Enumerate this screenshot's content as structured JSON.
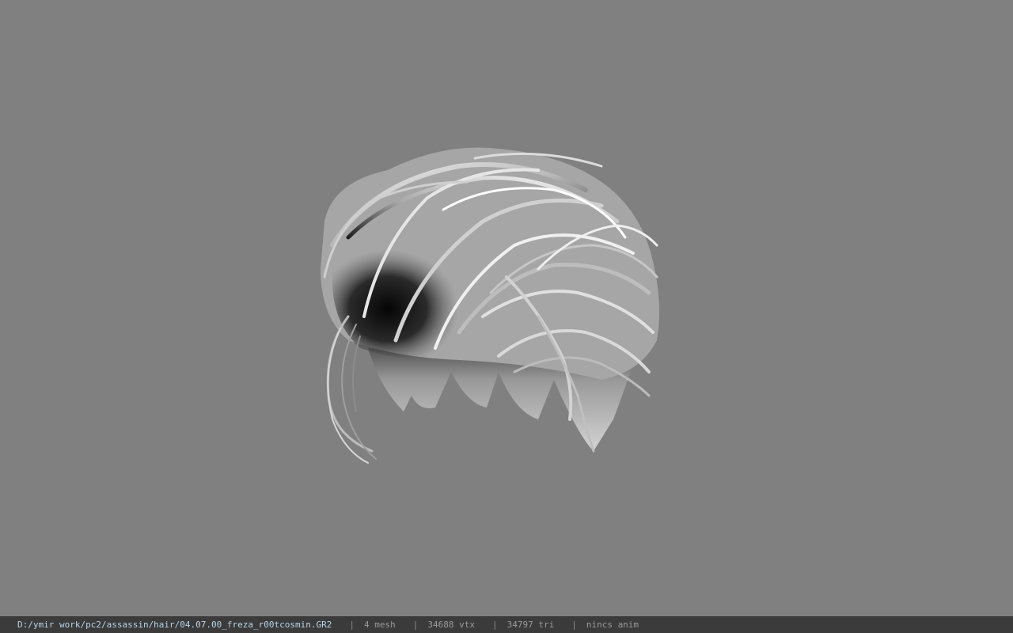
{
  "viewer": {
    "background_color": "#808080",
    "model_name_icon": "hair-mesh-render"
  },
  "statusbar": {
    "file_path": "D:/ymir work/pc2/assassin/hair/04.07.00_freza_r00tcosmin.GR2",
    "separator": "|",
    "mesh_count": "4 mesh",
    "vertex_count": "34688 vtx",
    "triangle_count": "34797 tri",
    "anim_info": "nincs anim"
  }
}
